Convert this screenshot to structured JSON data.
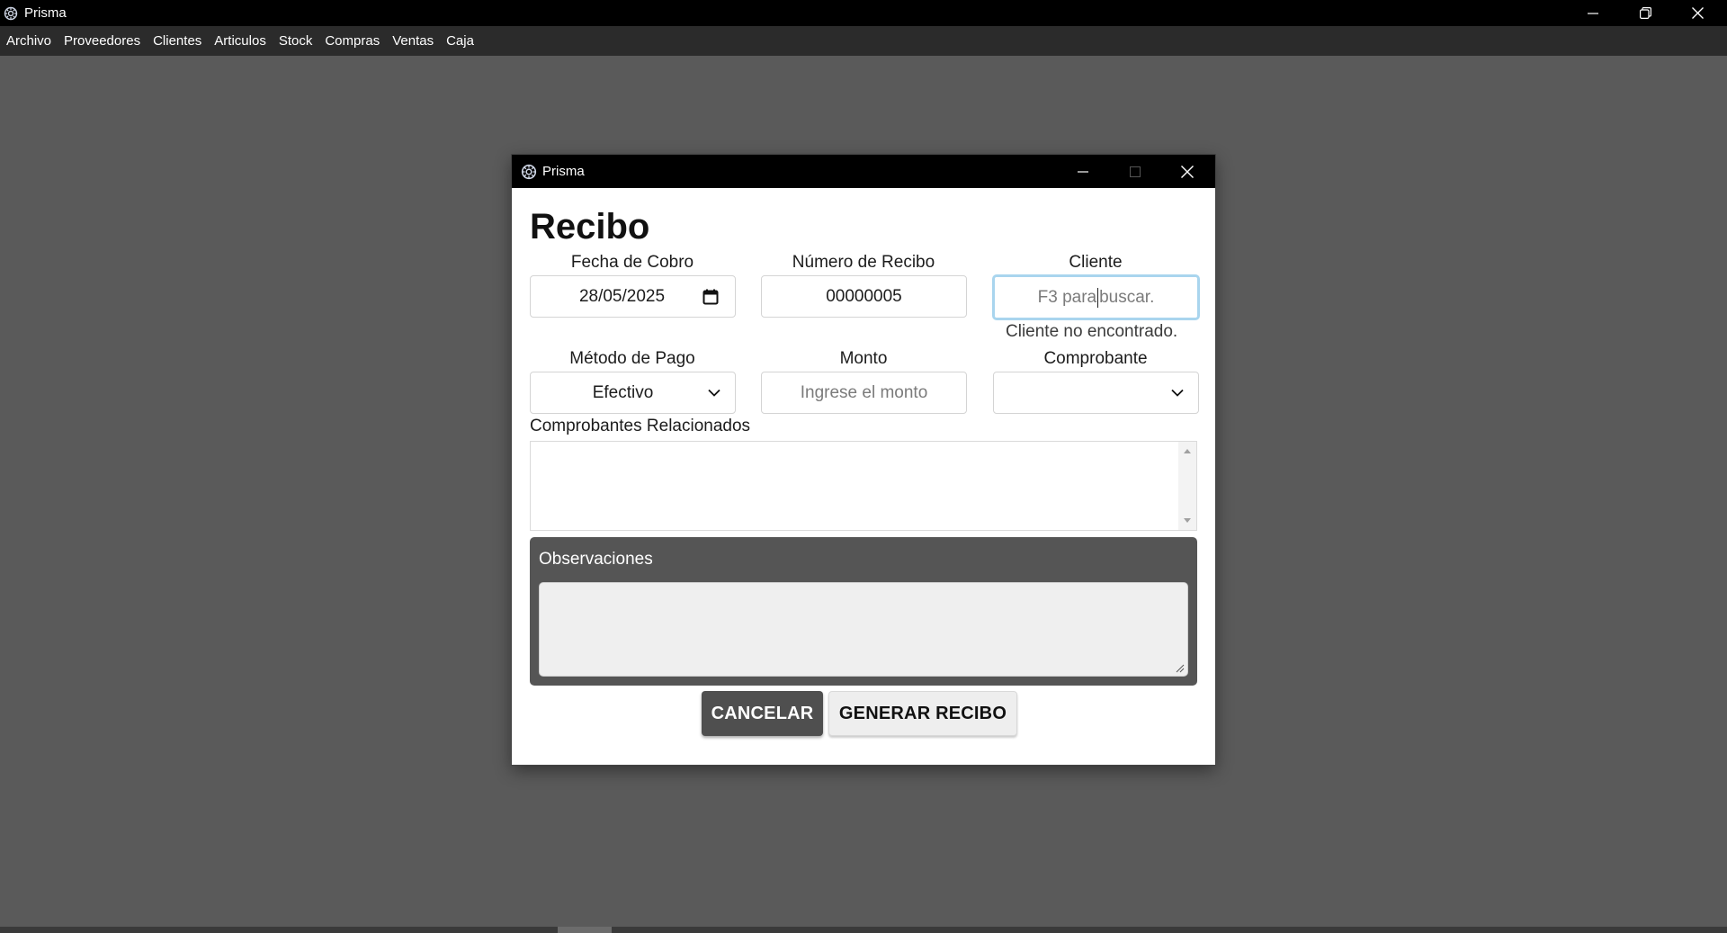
{
  "app": {
    "title": "Prisma",
    "icon": "gear-icon"
  },
  "menu": {
    "items": [
      {
        "label": "Archivo"
      },
      {
        "label": "Proveedores"
      },
      {
        "label": "Clientes"
      },
      {
        "label": "Articulos"
      },
      {
        "label": "Stock"
      },
      {
        "label": "Compras"
      },
      {
        "label": "Ventas"
      },
      {
        "label": "Caja"
      }
    ]
  },
  "dialog": {
    "title": "Prisma",
    "heading": "Recibo",
    "fecha": {
      "label": "Fecha de Cobro",
      "value": "28/05/2025",
      "icon": "calendar-icon"
    },
    "numero": {
      "label": "Número de Recibo",
      "value": "00000005"
    },
    "cliente": {
      "label": "Cliente",
      "placeholder_before": "F3 para",
      "placeholder_after": "buscar.",
      "message": "Cliente no encontrado."
    },
    "metodo": {
      "label": "Método de Pago",
      "value": "Efectivo",
      "icon": "chevron-down-icon"
    },
    "monto": {
      "label": "Monto",
      "placeholder": "Ingrese el monto"
    },
    "comprobante": {
      "label": "Comprobante",
      "value": "",
      "icon": "chevron-down-icon"
    },
    "relacionados": {
      "label": "Comprobantes Relacionados"
    },
    "observaciones": {
      "label": "Observaciones",
      "value": ""
    },
    "buttons": {
      "cancel": "CANCELAR",
      "generate": "GENERAR RECIBO"
    }
  },
  "colors": {
    "desktop": "#5a5a5a",
    "titlebar": "#000000",
    "menubar": "#2b2b2b",
    "panel": "#555555",
    "focus": "#a9d5ee"
  }
}
